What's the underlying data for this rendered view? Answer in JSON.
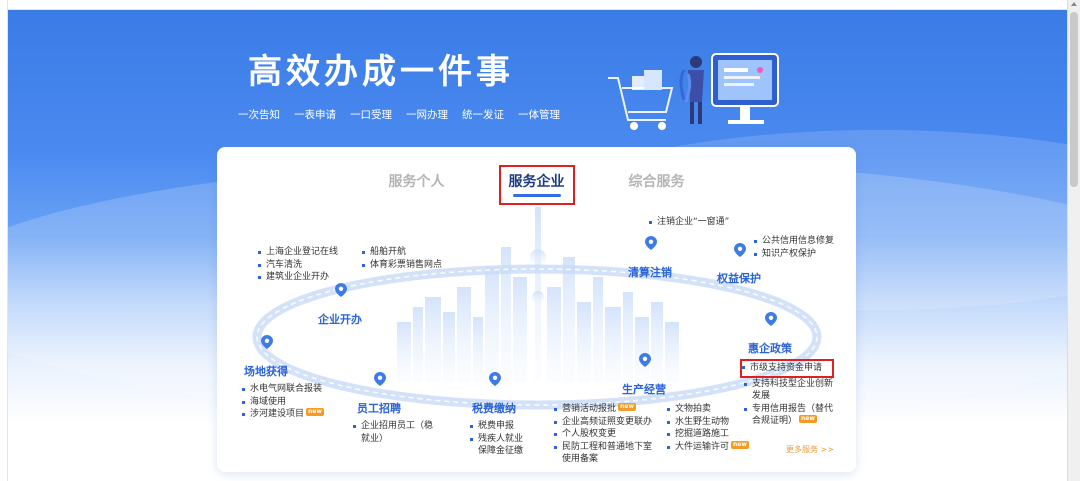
{
  "hero": {
    "title": "高效办成一件事",
    "tags": [
      "一次告知",
      "一表申请",
      "一口受理",
      "一网办理",
      "统一发证",
      "一体管理"
    ]
  },
  "tabs": [
    {
      "label": "服务个人",
      "active": false
    },
    {
      "label": "服务企业",
      "active": true
    },
    {
      "label": "综合服务",
      "active": false
    }
  ],
  "sections": {
    "kaiban": {
      "label": "企业开办",
      "col1": [
        "上海企业登记在线",
        "汽车清洗",
        "建筑业企业开办"
      ],
      "col2": [
        "船舶开航",
        "体育彩票销售网点"
      ]
    },
    "qingsuan": {
      "label": "清算注销",
      "items": [
        "注销企业“一窗通”"
      ]
    },
    "quanyi": {
      "label": "权益保护",
      "items": [
        "公共信用信息修复",
        "知识产权保护"
      ]
    },
    "changdi": {
      "label": "场地获得",
      "items": [
        "水电气网联合报装",
        "海域使用",
        "涉河建设项目"
      ]
    },
    "zhaopin": {
      "label": "员工招聘",
      "items": [
        "企业招用员工（稳就业）"
      ]
    },
    "shuifei": {
      "label": "税费缴纳",
      "items": [
        "税费申报",
        "残疾人就业保障金征缴"
      ]
    },
    "shengchan": {
      "label": "生产经营",
      "col1": [
        "营销活动报批",
        "企业高频证照变更联办",
        "个人股权变更",
        "民防工程和普通地下室使用备案"
      ],
      "col2": [
        "文物拍卖",
        "水生野生动物",
        "挖掘道路施工",
        "大件运输许可"
      ]
    },
    "huiqi": {
      "label": "惠企政策",
      "items": [
        "市级支持资金申请",
        "支持科技型企业创新发展",
        "专用信用报告（替代合规证明）"
      ]
    }
  },
  "badge": "new",
  "more_link": "更多服务 >>",
  "colors": {
    "accent": "#2a64d8",
    "highlight": "#e02020",
    "new_badge": "#f59a23"
  }
}
